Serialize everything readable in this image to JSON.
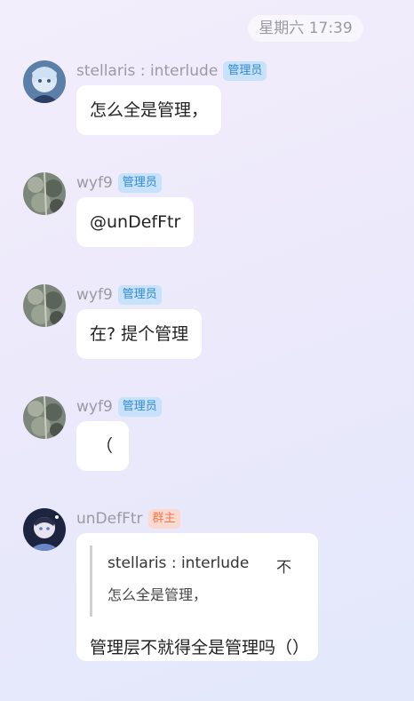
{
  "timestamp": "星期六 17:39",
  "messages": [
    {
      "sender": "stellaris : interlude",
      "badge": "管理员",
      "text": "怎么全是管理，"
    },
    {
      "sender": "wyf9",
      "badge": "管理员",
      "text": "@unDefFtr"
    },
    {
      "sender": "wyf9",
      "badge": "管理员",
      "text": "在? 提个管理"
    },
    {
      "sender": "wyf9",
      "badge": "管理员",
      "text": "（"
    },
    {
      "sender": "unDefFtr",
      "badge": "群主",
      "quote": {
        "sender": "stellaris : interlude",
        "flag": "不",
        "text": "怎么全是管理，"
      },
      "text": "管理层不就得全是管理吗（）"
    }
  ],
  "colors": {
    "admin_badge_bg": "#c9e2fb",
    "admin_badge_fg": "#2f8ad6",
    "owner_badge_bg": "#fbd9cf",
    "owner_badge_fg": "#ec7a50"
  }
}
